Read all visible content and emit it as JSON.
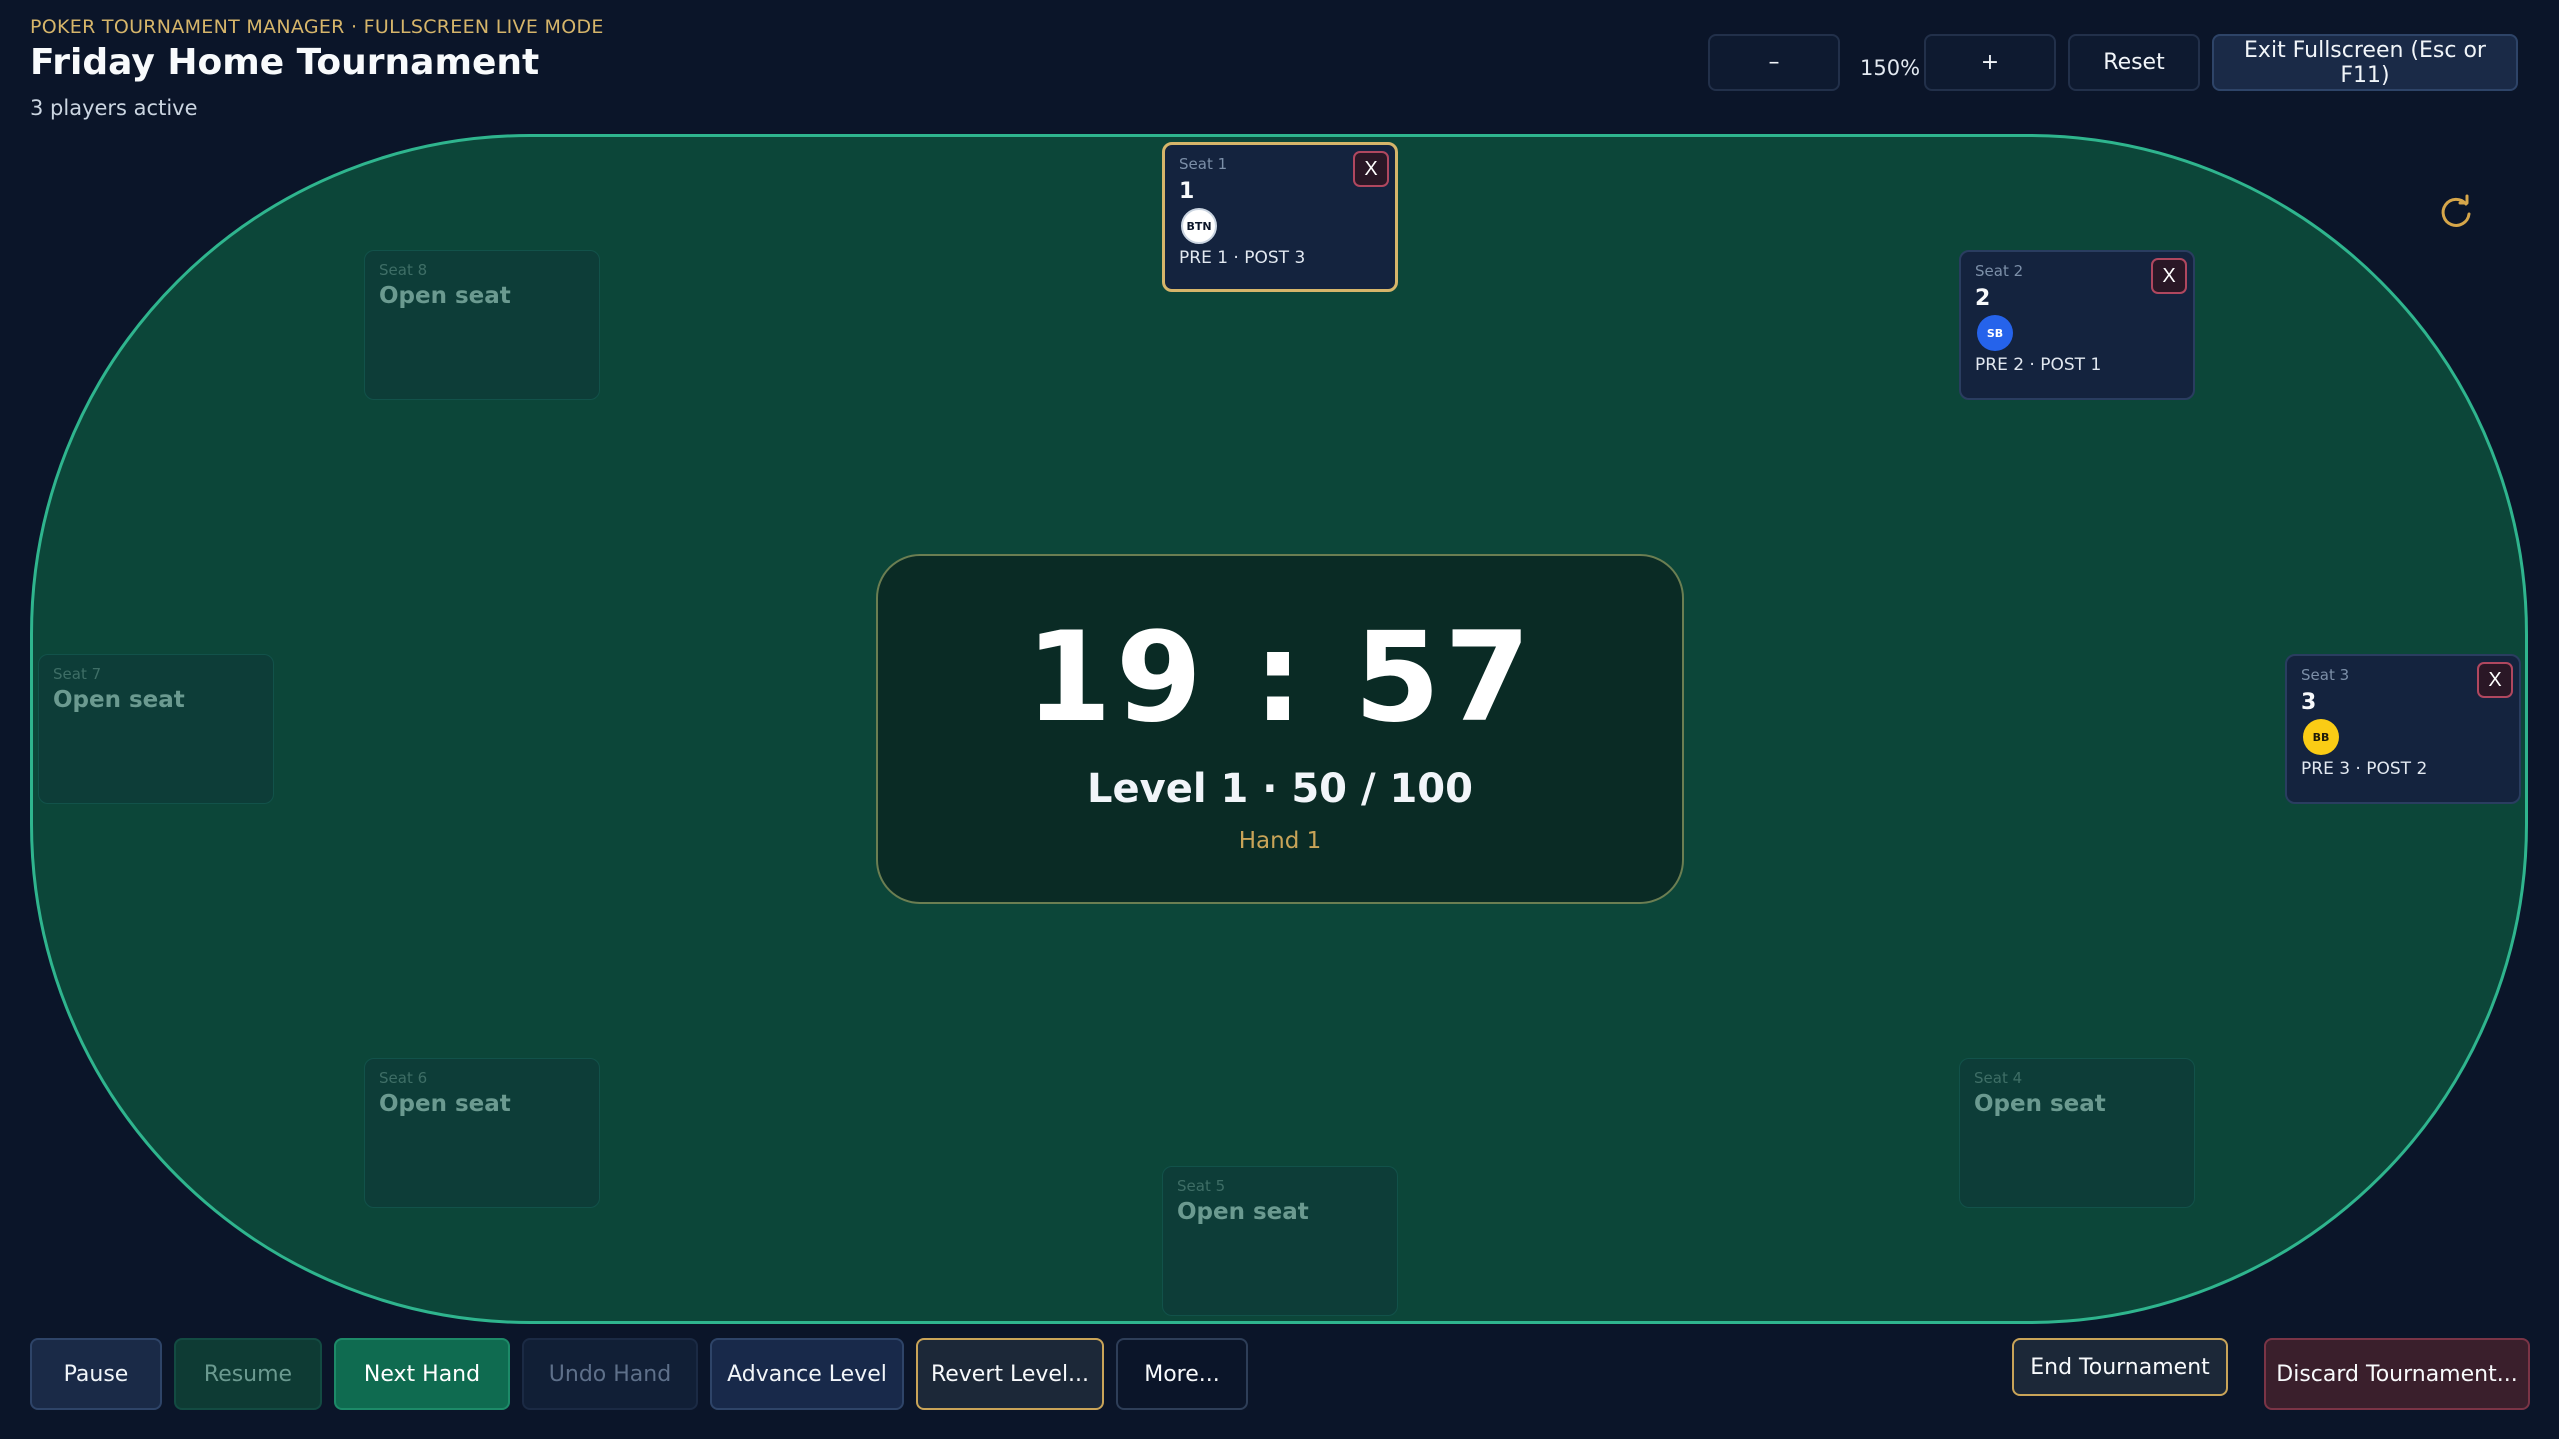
{
  "header": {
    "app_label": "POKER TOURNAMENT MANAGER · FULLSCREEN LIVE MODE",
    "title": "Friday Home Tournament",
    "subtitle": "3 players active"
  },
  "toolbar": {
    "zoom_out_label": "–",
    "zoom_level": "150%",
    "zoom_in_label": "+",
    "reset_label": "Reset",
    "exit_label": "Exit Fullscreen (Esc or F11)"
  },
  "icons": {
    "refresh": "refresh-icon"
  },
  "seats": {
    "seat1": {
      "label": "Seat 1",
      "player": "1",
      "badge": "BTN",
      "order": "PRE 1 · POST 3",
      "remove": "X"
    },
    "seat2": {
      "label": "Seat 2",
      "player": "2",
      "badge": "SB",
      "order": "PRE 2 · POST 1",
      "remove": "X"
    },
    "seat3": {
      "label": "Seat 3",
      "player": "3",
      "badge": "BB",
      "order": "PRE 3 · POST 2",
      "remove": "X"
    },
    "seat4": {
      "label": "Seat 4",
      "status": "Open seat"
    },
    "seat5": {
      "label": "Seat 5",
      "status": "Open seat"
    },
    "seat6": {
      "label": "Seat 6",
      "status": "Open seat"
    },
    "seat7": {
      "label": "Seat 7",
      "status": "Open seat"
    },
    "seat8": {
      "label": "Seat 8",
      "status": "Open seat"
    }
  },
  "clock": {
    "time": "19 : 57",
    "level": "Level 1 · 50 / 100",
    "hand": "Hand 1"
  },
  "actions": {
    "pause": "Pause",
    "resume": "Resume",
    "next_hand": "Next Hand",
    "undo_hand": "Undo Hand",
    "advance_level": "Advance Level",
    "revert_level": "Revert Level...",
    "more": "More...",
    "end_tournament": "End Tournament",
    "discard_tournament": "Discard Tournament..."
  },
  "colors": {
    "background": "#0b1529",
    "felt": "#0c4639",
    "felt_border": "#2fb58e",
    "accent_gold": "#d6b56a",
    "badge_sb": "#2563eb",
    "badge_bb": "#facc15"
  }
}
